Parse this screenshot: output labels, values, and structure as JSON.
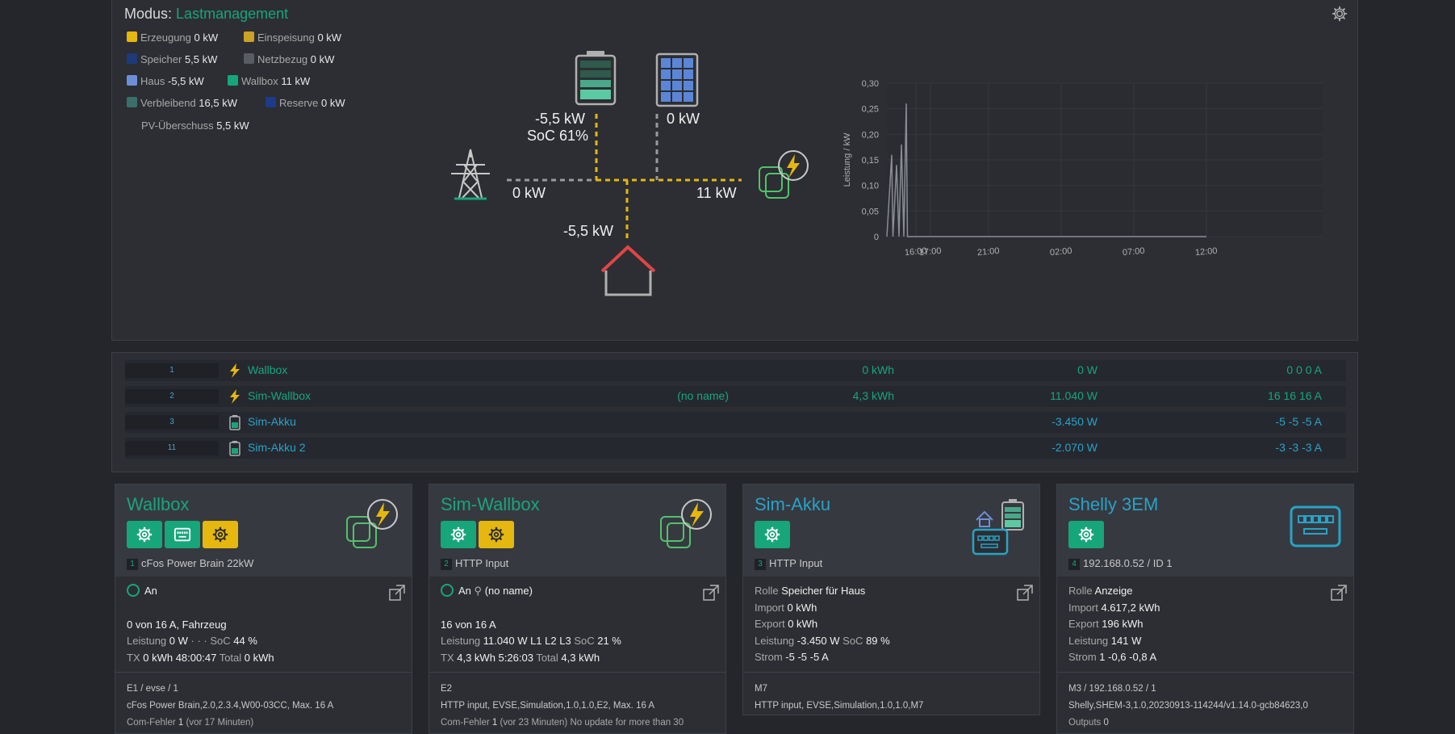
{
  "mode": {
    "label": "Modus:",
    "value": "Lastmanagement"
  },
  "legend": [
    {
      "label": "Erzeugung",
      "value": "0 kW",
      "color": "#e5b70f"
    },
    {
      "label": "Einspeisung",
      "value": "0 kW",
      "color": "#c9a227"
    },
    {
      "label": "Speicher",
      "value": "5,5 kW",
      "color": "#1e3a7a"
    },
    {
      "label": "Netzbezug",
      "value": "0 kW",
      "color": "#5a5c63"
    },
    {
      "label": "Haus",
      "value": "-5,5 kW",
      "color": "#6d8fd8"
    },
    {
      "label": "Wallbox",
      "value": "11 kW",
      "color": "#17a67a"
    },
    {
      "label": "Verbleibend",
      "value": "16,5 kW",
      "color": "#3a6f6a"
    },
    {
      "label": "Reserve",
      "value": "0 kW",
      "color": "#1e3a8a"
    },
    {
      "label": "PV-Überschuss",
      "value": "5,5 kW",
      "color": ""
    }
  ],
  "flow": {
    "battery_power": "-5,5 kW",
    "battery_soc": "SoC 61%",
    "solar_power": "0 kW",
    "grid_power": "0 kW",
    "wallbox_power": "11 kW",
    "house_power": "-5,5 kW"
  },
  "chart_data": {
    "type": "line",
    "ylabel": "Leistung / kW",
    "xlabel": "",
    "y_ticks": [
      "0,30",
      "0,25",
      "0,20",
      "0,15",
      "0,10",
      "0,05",
      "0"
    ],
    "x_ticks": [
      "16:00",
      "21:00",
      "02:00",
      "07:00",
      "12:00",
      "17:00"
    ],
    "ylim": [
      0,
      0.3
    ],
    "grid": true,
    "series": [
      {
        "color": "#8a8d94",
        "x": [
          "14:00",
          "14:20",
          "14:25",
          "14:40",
          "14:50",
          "15:00",
          "15:10",
          "15:20",
          "15:25",
          "15:35",
          "15:40",
          "12:00",
          "19:00"
        ],
        "y": [
          0,
          0.16,
          0,
          0.14,
          0,
          0.18,
          0,
          0.26,
          0,
          0,
          0,
          0,
          0
        ]
      }
    ]
  },
  "devices": [
    {
      "num": "1",
      "icon": "bolt",
      "name": "Wallbox",
      "label": "",
      "energy": "0 kWh",
      "power": "0 W",
      "current": "0 0 0 A",
      "color": "green"
    },
    {
      "num": "2",
      "icon": "bolt",
      "name": "Sim-Wallbox",
      "label": "(no name)",
      "energy": "4,3 kWh",
      "power": "11.040 W",
      "current": "16 16 16 A",
      "color": "green"
    },
    {
      "num": "3",
      "icon": "battery",
      "name": "Sim-Akku",
      "label": "",
      "energy": "",
      "power": "-3.450 W",
      "current": "-5 -5 -5 A",
      "color": "cyan"
    },
    {
      "num": "11",
      "icon": "battery",
      "name": "Sim-Akku 2",
      "label": "",
      "energy": "",
      "power": "-2.070 W",
      "current": "-3 -3 -3 A",
      "color": "cyan"
    }
  ],
  "cards": [
    {
      "title": "Wallbox",
      "num": "1",
      "sub": "cFos Power Brain 22kW",
      "status": "An",
      "line1": "0 von 16 A, Fahrzeug",
      "leistung_k": "Leistung",
      "leistung_v": "0 W",
      "leistung_extra": "· · ·",
      "soc_k": "SoC",
      "soc_v": "44 %",
      "tx_k": "TX",
      "tx_v": "0 kWh 48:00:47",
      "total_k": "Total",
      "total_v": "0 kWh",
      "foot1": "E1 / evse / 1",
      "foot2": "cFos Power Brain,2.0,2.3.4,W00-03CC",
      "foot2_max_k": ", Max.",
      "foot2_max_v": "16 A",
      "foot3_k": "Com-Fehler",
      "foot3_v": "1",
      "foot3_note": "(vor 17 Minuten)"
    },
    {
      "title": "Sim-Wallbox",
      "num": "2",
      "sub": "HTTP Input",
      "status": "An",
      "status_user": "(no name)",
      "line1": "16 von 16 A",
      "leistung_k": "Leistung",
      "leistung_v": "11.040 W L1 L2 L3",
      "soc_k": "SoC",
      "soc_v": "21 %",
      "tx_k": "TX",
      "tx_v": "4,3 kWh 5:26:03",
      "total_k": "Total",
      "total_v": "4,3 kWh",
      "foot1": "E2",
      "foot2": "HTTP input, EVSE,Simulation,1.0,1.0,E2",
      "foot2_max_k": ", Max.",
      "foot2_max_v": "16 A",
      "foot3_k": "Com-Fehler",
      "foot3_v": "1",
      "foot3_note": "(vor 23 Minuten) No update for more than 30"
    },
    {
      "title": "Sim-Akku",
      "num": "3",
      "sub": "HTTP Input",
      "rolle_k": "Rolle",
      "rolle_v": "Speicher für Haus",
      "import_k": "Import",
      "import_v": "0 kWh",
      "export_k": "Export",
      "export_v": "0 kWh",
      "leistung_k": "Leistung",
      "leistung_v": "-3.450 W",
      "soc_k": "SoC",
      "soc_v": "89 %",
      "strom_k": "Strom",
      "strom_v": "-5 -5 -5 A",
      "foot1": "M7",
      "foot2": "HTTP input, EVSE,Simulation,1.0,1.0,M7"
    },
    {
      "title": "Shelly 3EM",
      "num": "4",
      "sub": "192.168.0.52 / ID 1",
      "rolle_k": "Rolle",
      "rolle_v": "Anzeige",
      "import_k": "Import",
      "import_v": "4.617,2 kWh",
      "export_k": "Export",
      "export_v": "196 kWh",
      "leistung_k": "Leistung",
      "leistung_v": "141 W",
      "strom_k": "Strom",
      "strom_v": "1 -0,6 -0,8 A",
      "foot1": "M3 / 192.168.0.52 / 1",
      "foot2": "Shelly,SHEM-3,1.0,20230913-114244/v1.14.0-gcb84623,0",
      "foot3_k": "Outputs",
      "foot3_v": "0"
    }
  ]
}
